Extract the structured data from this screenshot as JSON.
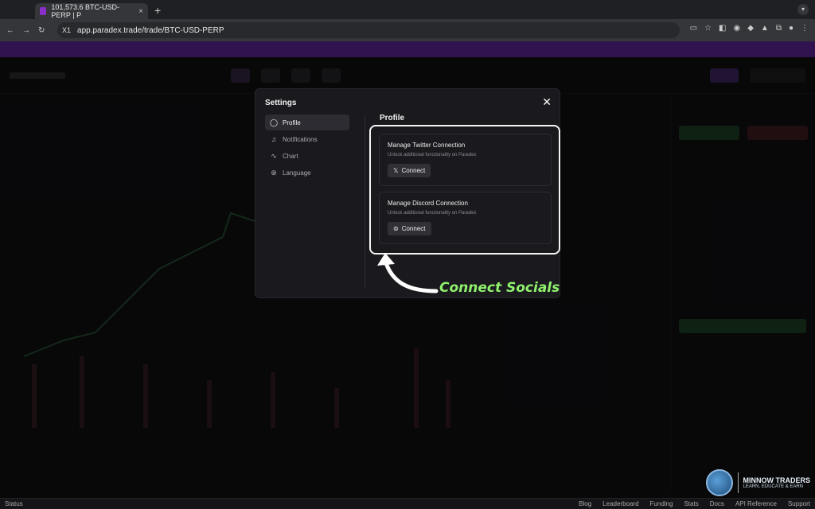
{
  "browser": {
    "tab_title": "101,573.6 BTC-USD-PERP | P",
    "tab_close": "×",
    "new_tab": "+",
    "profile_chip": "X1",
    "url": "app.paradex.trade/trade/BTC-USD-PERP"
  },
  "settings_modal": {
    "title": "Settings",
    "close": "✕",
    "menu": [
      {
        "label": "Profile",
        "icon": "user-circle-icon"
      },
      {
        "label": "Notifications",
        "icon": "bell-icon"
      },
      {
        "label": "Chart",
        "icon": "chart-line-icon"
      },
      {
        "label": "Language",
        "icon": "globe-icon"
      }
    ],
    "section_title": "Profile",
    "cards": [
      {
        "title": "Manage Twitter Connection",
        "desc": "Unlock additional functionality on Paradex",
        "button": "Connect",
        "icon": "x-logo-icon"
      },
      {
        "title": "Manage Discord Connection",
        "desc": "Unlock additional functionality on Paradex",
        "button": "Connect",
        "icon": "discord-icon"
      }
    ]
  },
  "annotation": "Connect Socials",
  "status_bar": {
    "status": "Status",
    "links": [
      "Blog",
      "Leaderboard",
      "Funding",
      "Stats",
      "Docs",
      "API Reference",
      "Support"
    ]
  },
  "watermark": {
    "line1": "MINNOW TRADERS",
    "line2": "LEARN, EDUCATE & EARN"
  },
  "colors": {
    "accent": "#8b2fc9",
    "annotation": "#8ff06c",
    "highlight": "#f4f4f4"
  }
}
